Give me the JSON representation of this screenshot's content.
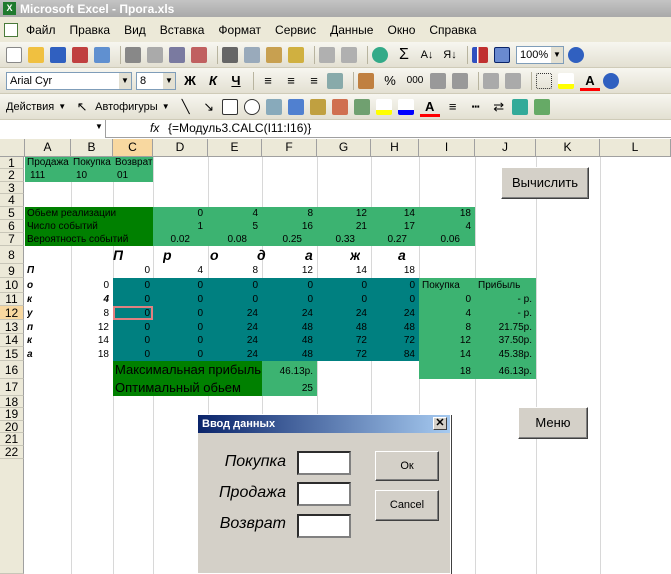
{
  "window": {
    "title": "Microsoft Excel - Прога.xls"
  },
  "menu": [
    "Файл",
    "Правка",
    "Вид",
    "Вставка",
    "Формат",
    "Сервис",
    "Данные",
    "Окно",
    "Справка"
  ],
  "toolbar": {
    "zoom": "100%",
    "font": "Arial Cyr",
    "size": "8",
    "bold": "Ж",
    "italic": "К",
    "underline": "Ч",
    "percent": "%",
    "thousands": "000",
    "actions": "Действия",
    "autoshapes": "Автофигуры"
  },
  "formula_bar": {
    "name_box": "",
    "fx": "fx",
    "formula": "{=Модуль3.CALC(I11:I16)}"
  },
  "columns": [
    "A",
    "B",
    "C",
    "D",
    "E",
    "F",
    "G",
    "H",
    "I",
    "J",
    "K",
    "L"
  ],
  "rows": [
    "1",
    "2",
    "3",
    "4",
    "5",
    "6",
    "7",
    "8",
    "9",
    "10",
    "11",
    "12",
    "13",
    "14",
    "15",
    "16",
    "17",
    "18",
    "19",
    "20",
    "21",
    "22"
  ],
  "header_row": {
    "sell": "Продажа",
    "buy": "Покупка",
    "ret": "Возврат"
  },
  "input_row": {
    "sell": "111",
    "buy": "10",
    "ret": "01"
  },
  "stats": {
    "volume_label": "Обьем реализации",
    "volume": [
      "0",
      "4",
      "8",
      "12",
      "14",
      "18"
    ],
    "count_label": "Число событий",
    "count": [
      "1",
      "5",
      "16",
      "21",
      "17",
      "4"
    ],
    "prob_label": "Вероятность событий",
    "prob": [
      "0.02",
      "0.08",
      "0.25",
      "0.33",
      "0.27",
      "0.06"
    ]
  },
  "sales_title": [
    "П",
    "р",
    "о",
    "д",
    "а",
    "ж",
    "а"
  ],
  "sales_cols": [
    "0",
    "4",
    "8",
    "12",
    "14",
    "18"
  ],
  "purchase_letters": [
    "П",
    "о",
    "к",
    "у",
    "п",
    "к",
    "а"
  ],
  "matrix": [
    {
      "buy": "0",
      "vals": [
        "0",
        "0",
        "0",
        "0",
        "0",
        "0"
      ]
    },
    {
      "buy": "4",
      "vals": [
        "0",
        "0",
        "0",
        "0",
        "0",
        "0"
      ]
    },
    {
      "buy": "8",
      "vals": [
        "0",
        "0",
        "24",
        "24",
        "24",
        "24"
      ]
    },
    {
      "buy": "12",
      "vals": [
        "0",
        "0",
        "24",
        "48",
        "48",
        "48"
      ]
    },
    {
      "buy": "14",
      "vals": [
        "0",
        "0",
        "24",
        "48",
        "72",
        "72"
      ]
    },
    {
      "buy": "18",
      "vals": [
        "0",
        "0",
        "24",
        "48",
        "72",
        "84"
      ]
    }
  ],
  "profit_table": {
    "h_buy": "Покупка",
    "h_profit": "Прибыль",
    "rows": [
      [
        "0",
        "-   р."
      ],
      [
        "4",
        "-   р."
      ],
      [
        "8",
        "21.75р."
      ],
      [
        "12",
        "37.50р."
      ],
      [
        "14",
        "45.38р."
      ],
      [
        "18",
        "46.13р."
      ]
    ]
  },
  "results": {
    "max_label": "Максимальная прибыль",
    "max_value": "46.13р.",
    "opt_label": "Оптимальный обьем",
    "opt_value": "25"
  },
  "buttons": {
    "calc": "Вычислить",
    "menu": "Меню"
  },
  "dialog": {
    "title": "Ввод данных",
    "close": "✕",
    "buy": "Покупка",
    "sell": "Продажа",
    "ret": "Возврат",
    "ok": "Ок",
    "cancel": "Cancel"
  }
}
